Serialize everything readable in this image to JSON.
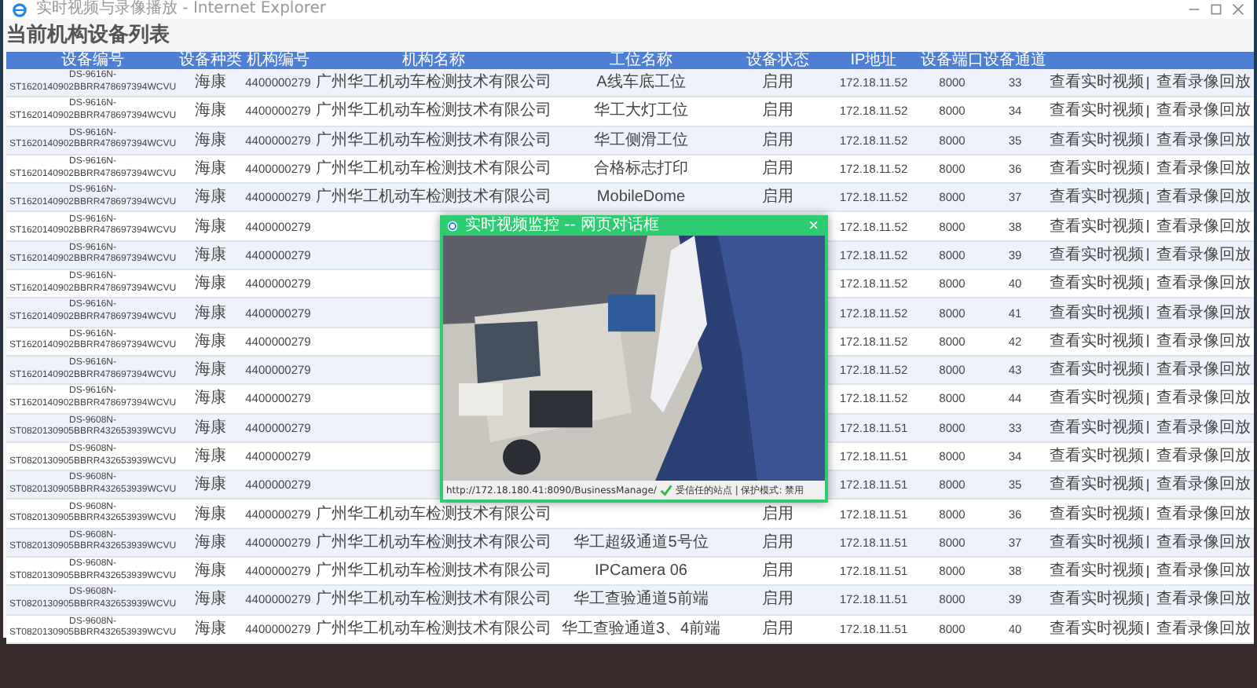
{
  "window": {
    "title": "实时视频与录像播放 - Internet Explorer"
  },
  "page_title": "当前机构设备列表",
  "table": {
    "columns": [
      "设备编号",
      "设备种类",
      "机构编号",
      "机构名称",
      "工位名称",
      "设备状态",
      "IP地址",
      "设备端口",
      "设备通道",
      ""
    ],
    "rows": [
      {
        "device_no": "DS-9616N-ST1620140902BBRR478697394WCVU",
        "type": "海康",
        "org_code": "4400000279",
        "org_name": "广州华工机动车检测技术有限公司",
        "station": "A线车底工位",
        "status": "启用",
        "ip": "172.18.11.52",
        "port": "8000",
        "channel": "33",
        "actions": [
          "查看实时视频",
          "查看录像回放"
        ]
      },
      {
        "device_no": "DS-9616N-ST1620140902BBRR478697394WCVU",
        "type": "海康",
        "org_code": "4400000279",
        "org_name": "广州华工机动车检测技术有限公司",
        "station": "华工大灯工位",
        "status": "启用",
        "ip": "172.18.11.52",
        "port": "8000",
        "channel": "34",
        "actions": [
          "查看实时视频",
          "查看录像回放"
        ]
      },
      {
        "device_no": "DS-9616N-ST1620140902BBRR478697394WCVU",
        "type": "海康",
        "org_code": "4400000279",
        "org_name": "广州华工机动车检测技术有限公司",
        "station": "华工侧滑工位",
        "status": "启用",
        "ip": "172.18.11.52",
        "port": "8000",
        "channel": "35",
        "actions": [
          "查看实时视频",
          "查看录像回放"
        ]
      },
      {
        "device_no": "DS-9616N-ST1620140902BBRR478697394WCVU",
        "type": "海康",
        "org_code": "4400000279",
        "org_name": "广州华工机动车检测技术有限公司",
        "station": "合格标志打印",
        "status": "启用",
        "ip": "172.18.11.52",
        "port": "8000",
        "channel": "36",
        "actions": [
          "查看实时视频",
          "查看录像回放"
        ]
      },
      {
        "device_no": "DS-9616N-ST1620140902BBRR478697394WCVU",
        "type": "海康",
        "org_code": "4400000279",
        "org_name": "广州华工机动车检测技术有限公司",
        "station": "MobileDome",
        "status": "启用",
        "ip": "172.18.11.52",
        "port": "8000",
        "channel": "37",
        "actions": [
          "查看实时视频",
          "查看录像回放"
        ]
      },
      {
        "device_no": "DS-9616N-ST1620140902BBRR478697394WCVU",
        "type": "海康",
        "org_code": "4400000279",
        "ip": "172.18.11.52",
        "port": "8000",
        "channel": "38",
        "actions": [
          "查看实时视频",
          "查看录像回放"
        ]
      },
      {
        "device_no": "DS-9616N-ST1620140902BBRR478697394WCVU",
        "type": "海康",
        "org_code": "4400000279",
        "ip": "172.18.11.52",
        "port": "8000",
        "channel": "39",
        "actions": [
          "查看实时视频",
          "查看录像回放"
        ]
      },
      {
        "device_no": "DS-9616N-ST1620140902BBRR478697394WCVU",
        "type": "海康",
        "org_code": "4400000279",
        "ip": "172.18.11.52",
        "port": "8000",
        "channel": "40",
        "actions": [
          "查看实时视频",
          "查看录像回放"
        ]
      },
      {
        "device_no": "DS-9616N-ST1620140902BBRR478697394WCVU",
        "type": "海康",
        "org_code": "4400000279",
        "ip": "172.18.11.52",
        "port": "8000",
        "channel": "41",
        "actions": [
          "查看实时视频",
          "查看录像回放"
        ]
      },
      {
        "device_no": "DS-9616N-ST1620140902BBRR478697394WCVU",
        "type": "海康",
        "org_code": "4400000279",
        "ip": "172.18.11.52",
        "port": "8000",
        "channel": "42",
        "actions": [
          "查看实时视频",
          "查看录像回放"
        ]
      },
      {
        "device_no": "DS-9616N-ST1620140902BBRR478697394WCVU",
        "type": "海康",
        "org_code": "4400000279",
        "ip": "172.18.11.52",
        "port": "8000",
        "channel": "43",
        "actions": [
          "查看实时视频",
          "查看录像回放"
        ]
      },
      {
        "device_no": "DS-9616N-ST1620140902BBRR478697394WCVU",
        "type": "海康",
        "org_code": "4400000279",
        "ip": "172.18.11.52",
        "port": "8000",
        "channel": "44",
        "actions": [
          "查看实时视频",
          "查看录像回放"
        ]
      },
      {
        "device_no": "DS-9608N-ST0820130905BBRR432653939WCVU",
        "type": "海康",
        "org_code": "4400000279",
        "ip": "172.18.11.51",
        "port": "8000",
        "channel": "33",
        "actions": [
          "查看实时视频",
          "查看录像回放"
        ]
      },
      {
        "device_no": "DS-9608N-ST0820130905BBRR432653939WCVU",
        "type": "海康",
        "org_code": "4400000279",
        "ip": "172.18.11.51",
        "port": "8000",
        "channel": "34",
        "actions": [
          "查看实时视频",
          "查看录像回放"
        ]
      },
      {
        "device_no": "DS-9608N-ST0820130905BBRR432653939WCVU",
        "type": "海康",
        "org_code": "4400000279",
        "ip": "172.18.11.51",
        "port": "8000",
        "channel": "35",
        "actions": [
          "查看实时视频",
          "查看录像回放"
        ]
      },
      {
        "device_no": "DS-9608N-ST0820130905BBRR432653939WCVU",
        "type": "海康",
        "org_code": "4400000279",
        "org_name": "广州华工机动车检测技术有限公司",
        "status": "启用",
        "ip": "172.18.11.51",
        "port": "8000",
        "channel": "36",
        "actions": [
          "查看实时视频",
          "查看录像回放"
        ]
      },
      {
        "device_no": "DS-9608N-ST0820130905BBRR432653939WCVU",
        "type": "海康",
        "org_code": "4400000279",
        "org_name": "广州华工机动车检测技术有限公司",
        "station": "华工超级通道5号位",
        "status": "启用",
        "ip": "172.18.11.51",
        "port": "8000",
        "channel": "37",
        "actions": [
          "查看实时视频",
          "查看录像回放"
        ]
      },
      {
        "device_no": "DS-9608N-ST0820130905BBRR432653939WCVU",
        "type": "海康",
        "org_code": "4400000279",
        "org_name": "广州华工机动车检测技术有限公司",
        "station": "IPCamera 06",
        "status": "启用",
        "ip": "172.18.11.51",
        "port": "8000",
        "channel": "38",
        "actions": [
          "查看实时视频",
          "查看录像回放"
        ]
      },
      {
        "device_no": "DS-9608N-ST0820130905BBRR432653939WCVU",
        "type": "海康",
        "org_code": "4400000279",
        "org_name": "广州华工机动车检测技术有限公司",
        "station": "华工查验通道5前端",
        "status": "启用",
        "ip": "172.18.11.51",
        "port": "8000",
        "channel": "39",
        "actions": [
          "查看实时视频",
          "查看录像回放"
        ]
      },
      {
        "device_no": "DS-9608N-ST0820130905BBRR432653939WCVU",
        "type": "海康",
        "org_code": "4400000279",
        "org_name": "广州华工机动车检测技术有限公司",
        "station": "华工查验通道3、4前端",
        "status": "启用",
        "ip": "172.18.11.51",
        "port": "8000",
        "channel": "40",
        "actions": [
          "查看实时视频",
          "查看录像回放"
        ]
      }
    ]
  },
  "dialog": {
    "title": "实时视频监控 -- 网页对话框",
    "close": "×",
    "status_bar": {
      "url": "http://172.18.180.41:8090/BusinessManage/",
      "zone": "受信任的站点 | 保护模式: 禁用"
    }
  }
}
